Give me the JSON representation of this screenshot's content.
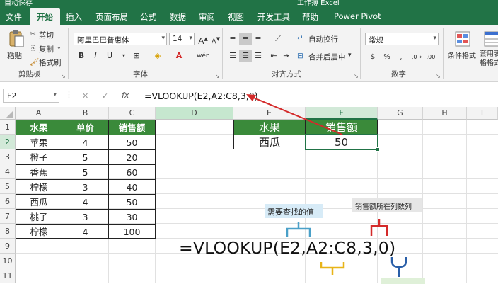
{
  "title_bar": {
    "left_text": "自动保存",
    "center_text": "工作簿 Excel"
  },
  "tabs": [
    "文件",
    "开始",
    "插入",
    "页面布局",
    "公式",
    "数据",
    "审阅",
    "视图",
    "开发工具",
    "帮助",
    "Power Pivot"
  ],
  "active_tab": "开始",
  "ribbon": {
    "clipboard": {
      "cut": "剪切",
      "copy": "复制",
      "format_painter": "格式刷",
      "paste": "粘贴",
      "group_label": "剪贴板"
    },
    "font": {
      "font_name": "阿里巴巴普惠体",
      "font_size": "14",
      "bold": "B",
      "italic": "I",
      "underline": "U",
      "group_label": "字体"
    },
    "alignment": {
      "wrap_text": "自动换行",
      "merge_center": "合并后居中",
      "group_label": "对齐方式"
    },
    "number": {
      "format": "常规",
      "group_label": "数字"
    },
    "styles": {
      "conditional_format": "条件格式",
      "table_format": "套用表格格式"
    }
  },
  "formula_bar": {
    "name_box": "F2",
    "fx": "fx",
    "cancel": "✕",
    "enter": "✓",
    "formula": "=VLOOKUP(E2,A2:C8,3,0)"
  },
  "columns": [
    "A",
    "B",
    "C",
    "D",
    "E",
    "F",
    "G",
    "H",
    "I"
  ],
  "rows": [
    "1",
    "2",
    "3",
    "4",
    "5",
    "6",
    "7",
    "8",
    "9",
    "10",
    "11"
  ],
  "table": {
    "headers": [
      "水果",
      "单价",
      "销售额"
    ],
    "rows": [
      [
        "苹果",
        "4",
        "50"
      ],
      [
        "橙子",
        "5",
        "20"
      ],
      [
        "香蕉",
        "5",
        "60"
      ],
      [
        "柠檬",
        "3",
        "40"
      ],
      [
        "西瓜",
        "4",
        "50"
      ],
      [
        "桃子",
        "3",
        "30"
      ],
      [
        "柠檬",
        "4",
        "100"
      ]
    ]
  },
  "lookup": {
    "header_fruit": "水果",
    "header_sales": "销售额",
    "fruit": "西瓜",
    "result": "50"
  },
  "annotations": {
    "lookup_value": "需要查找的值",
    "column_note": "销售额所在列数列",
    "big_formula": "=VLOOKUP(E2,A2:C8,3,0)"
  },
  "colors": {
    "excel_green": "#217346",
    "header_green": "#3a8a3a",
    "arrow_red": "#d42a2a",
    "bracket_blue": "#4aa0c8",
    "bracket_yellow": "#e8b418"
  }
}
